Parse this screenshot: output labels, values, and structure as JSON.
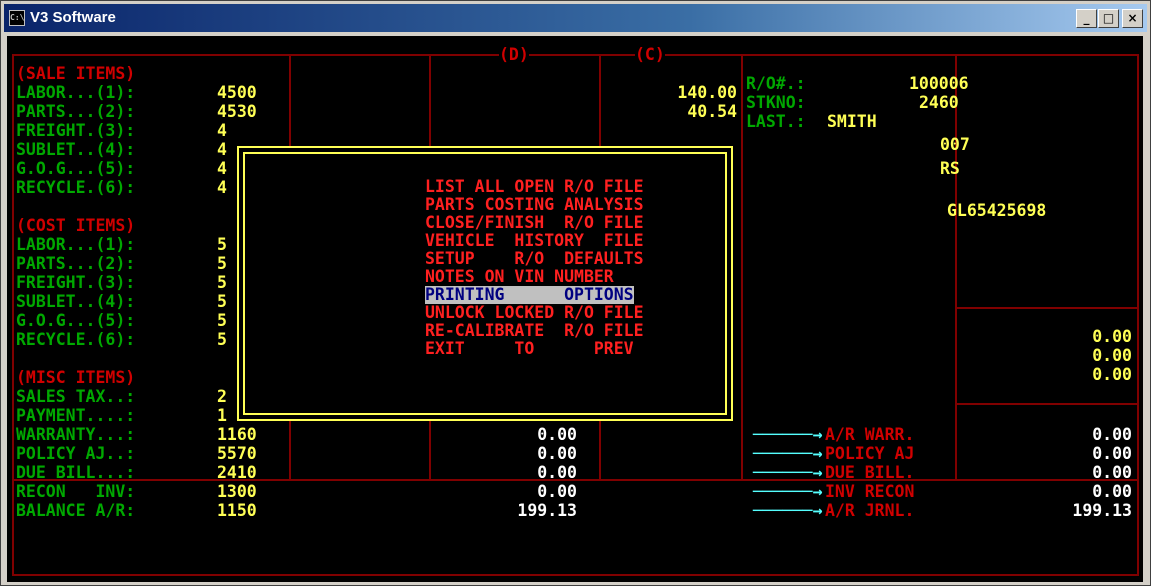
{
  "window": {
    "title": "V3 Software",
    "icon": "C:\\",
    "controls": [
      "_",
      "□",
      "×"
    ]
  },
  "headers": {
    "col_d": "(D)",
    "col_c": "(C)"
  },
  "sections": {
    "sale": "(SALE ITEMS)",
    "cost": "(COST ITEMS)",
    "misc": "(MISC ITEMS)"
  },
  "left_rows": [
    {
      "label": "LABOR...(1):",
      "value": "4500"
    },
    {
      "label": "PARTS...(2):",
      "value": "4530"
    },
    {
      "label": "FREIGHT.(3):",
      "value": "4"
    },
    {
      "label": "SUBLET..(4):",
      "value": "4"
    },
    {
      "label": "G.O.G...(5):",
      "value": "4"
    },
    {
      "label": "RECYCLE.(6):",
      "value": "4"
    },
    {
      "label": "LABOR...(1):",
      "value": "5"
    },
    {
      "label": "PARTS...(2):",
      "value": "5"
    },
    {
      "label": "FREIGHT.(3):",
      "value": "5"
    },
    {
      "label": "SUBLET..(4):",
      "value": "5"
    },
    {
      "label": "G.O.G...(5):",
      "value": "5"
    },
    {
      "label": "RECYCLE.(6):",
      "value": "5"
    },
    {
      "label": "SALES TAX..:",
      "value": "2"
    },
    {
      "label": "PAYMENT....:",
      "value": "1"
    },
    {
      "label": "WARRANTY...:",
      "value": "1160"
    },
    {
      "label": "POLICY AJ..:",
      "value": "5570"
    },
    {
      "label": "DUE BILL...:",
      "value": "2410"
    },
    {
      "label": "RECON   INV:",
      "value": "1300"
    },
    {
      "label": "BALANCE A/R:",
      "value": "1150"
    }
  ],
  "col_c_values": [
    "140.00",
    "40.54"
  ],
  "ro_info": {
    "ro_label": "R/O#.:",
    "ro_value": "100006",
    "stk_label": "STKNO:",
    "stk_value": "2460",
    "last_label": "LAST.:",
    "last_value": "SMITH",
    "partial1": "007",
    "partial2": "RS",
    "partial3": "GL65425698"
  },
  "right_totals": [
    "0.00",
    "0.00",
    "0.00"
  ],
  "bottom_mid_values": [
    "0.00",
    "0.00",
    "0.00",
    "0.00",
    "199.13"
  ],
  "journal": [
    {
      "label": "A/R WARR.",
      "value": "0.00"
    },
    {
      "label": "POLICY AJ",
      "value": "0.00"
    },
    {
      "label": "DUE BILL.",
      "value": "0.00"
    },
    {
      "label": "INV RECON",
      "value": "0.00"
    },
    {
      "label": "A/R JRNL.",
      "value": "199.13"
    }
  ],
  "menu": {
    "items": [
      "LIST ALL OPEN R/O FILE",
      "PARTS COSTING ANALYSIS",
      "CLOSE/FINISH  R/O FILE",
      "VEHICLE  HISTORY  FILE",
      "SETUP    R/O  DEFAULTS",
      "NOTES ON VIN NUMBER",
      "PRINTING      OPTIONS",
      "UNLOCK LOCKED R/O FILE",
      "RE-CALIBRATE  R/O FILE",
      "EXIT     TO      PREV"
    ],
    "selected_index": 6
  },
  "colors": {
    "frame": "#800000",
    "label": "#00a800",
    "value": "#ffff55",
    "menu_text": "#ff2020",
    "highlight_bg": "#c0c0c0",
    "arrow": "#55ffff"
  }
}
